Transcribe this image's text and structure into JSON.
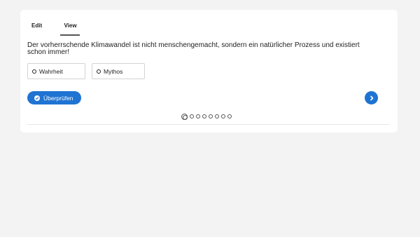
{
  "tabs": {
    "edit": "Edit",
    "view": "View",
    "active": "view"
  },
  "question": "Der vorherrschende Klimawandel ist nicht menschengemacht, sondern ein natürlicher Prozess und existiert schon immer!",
  "answers": [
    {
      "label": "Wahrheit",
      "selected": false
    },
    {
      "label": "Mythos",
      "selected": false
    }
  ],
  "check_button": {
    "label": "Überprüfen",
    "icon": "check-circle-icon"
  },
  "next_button": {
    "icon": "chevron-right-icon"
  },
  "pagination": {
    "total": 8,
    "current": 1
  },
  "colors": {
    "accent": "#1f73d2",
    "background": "#f3f3f3",
    "card": "#ffffff"
  }
}
